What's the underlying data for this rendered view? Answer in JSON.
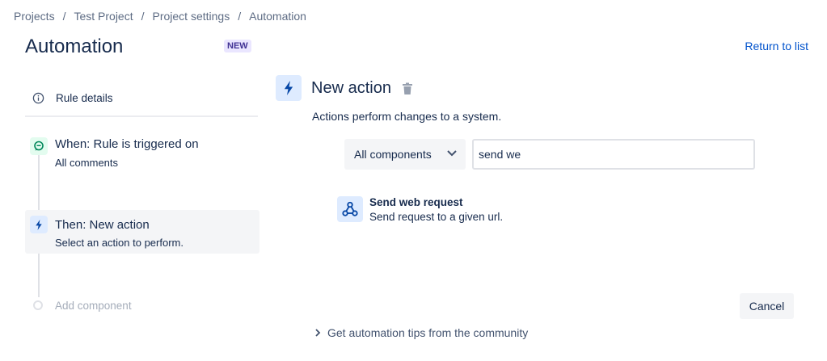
{
  "breadcrumb": {
    "items": [
      "Projects",
      "Test Project",
      "Project settings",
      "Automation"
    ],
    "separator": "/"
  },
  "header": {
    "title": "Automation",
    "badge": "NEW",
    "return_link": "Return to list"
  },
  "sidebar": {
    "rule_details": {
      "label": "Rule details",
      "icon": "info-icon"
    },
    "trigger": {
      "title": "When: Rule is triggered on",
      "subtitle": "All comments",
      "icon": "comment-icon"
    },
    "action": {
      "title": "Then: New action",
      "subtitle": "Select an action to perform.",
      "icon": "lightning-icon"
    },
    "add_component": "Add component"
  },
  "main": {
    "title": "New action",
    "description": "Actions perform changes to a system.",
    "filter": {
      "selected": "All components"
    },
    "search": {
      "value": "send we"
    },
    "results": [
      {
        "title": "Send web request",
        "subtitle": "Send request to a given url.",
        "icon": "webhook-icon"
      }
    ],
    "cancel_label": "Cancel",
    "tips_link": "Get automation tips from the community"
  },
  "colors": {
    "link": "#0052cc",
    "text": "#172b4d",
    "subtle": "#5e6c84",
    "badge_bg": "#eae6ff",
    "badge_text": "#403294",
    "icon_bg_blue": "#deebff",
    "icon_bg_green": "#e3fcef"
  }
}
